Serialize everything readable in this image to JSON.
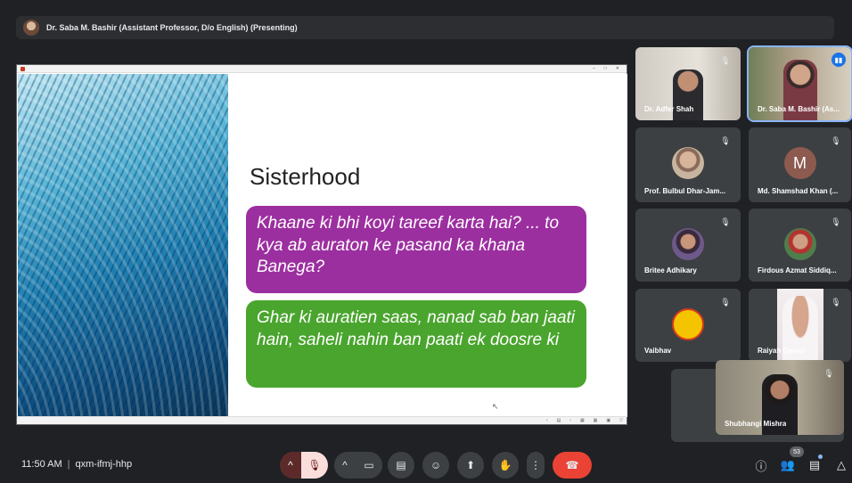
{
  "presenter_bar": {
    "label": "Dr. Saba M. Bashir (Assistant Professor, D/o English) (Presenting)"
  },
  "slide": {
    "title": "Sisterhood",
    "quote1": "Khaane ki bhi koyi tareef karta hai? ... to kya ab auraton ke pasand ka khana Banega?",
    "quote2": "Ghar ki auratien saas, nanad sab ban jaati hain, saheli nahin ban paati ek doosre ki",
    "colors": {
      "quote1_bg": "#9c2fa0",
      "quote2_bg": "#4aa52e"
    }
  },
  "participants": [
    {
      "name": "Dr. Adfer Shah",
      "type": "video",
      "muted": true
    },
    {
      "name": "Dr. Saba M. Bashir (As...",
      "type": "video",
      "speaking": true
    },
    {
      "name": "Prof. Bulbul Dhar-Jam...",
      "type": "photo",
      "muted": true
    },
    {
      "name": "Md. Shamshad Khan (...",
      "type": "letter",
      "letter": "M",
      "muted": true
    },
    {
      "name": "Britee Adhikary",
      "type": "photo",
      "muted": true
    },
    {
      "name": "Firdous Azmat Siddiq...",
      "type": "photo",
      "muted": true
    },
    {
      "name": "Vaibhav",
      "type": "logo",
      "logo_text": "BREAK THE SHAME",
      "muted": true
    },
    {
      "name": "Raiyah Qamar",
      "type": "video",
      "muted": true
    },
    {
      "name": "Shubhangi Mishra",
      "type": "video",
      "muted": true
    }
  ],
  "bottom_bar": {
    "time": "11:50 AM",
    "meeting_code": "qxm-ifmj-hhp",
    "participant_count": "53",
    "icons": {
      "mic_options": "chevron-up-icon",
      "mic": "mic-off-icon",
      "cam_options": "chevron-up-icon",
      "camera": "camera-icon",
      "captions": "captions-icon",
      "emoji": "emoji-icon",
      "present": "present-icon",
      "hand": "raise-hand-icon",
      "more": "more-options-icon",
      "end_call": "end-call-icon",
      "info": "info-icon",
      "people": "people-icon",
      "chat": "chat-icon",
      "activities": "activities-icon"
    }
  }
}
